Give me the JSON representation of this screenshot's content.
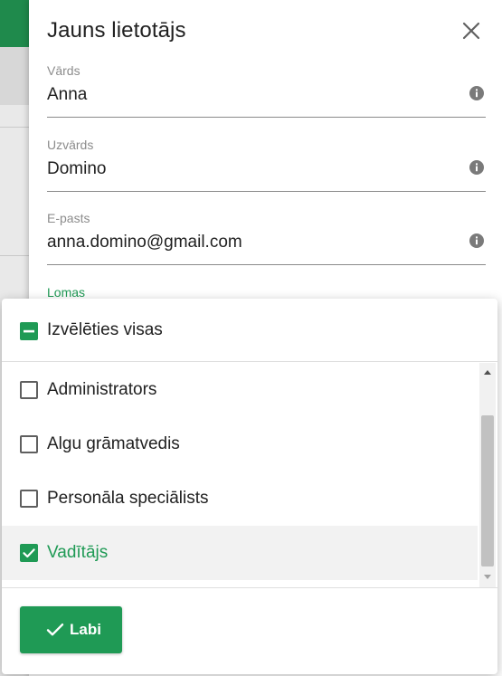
{
  "drawer": {
    "title": "Jauns lietotājs",
    "close_icon": "close-icon"
  },
  "fields": [
    {
      "label": "Vārds",
      "value": "Anna",
      "icon": "info-icon"
    },
    {
      "label": "Uzvārds",
      "value": "Domino",
      "icon": "info-icon"
    },
    {
      "label": "E-pasts",
      "value": "anna.domino@gmail.com",
      "icon": "info-icon"
    }
  ],
  "roles": {
    "label": "Lomas",
    "select_all_label": "Izvēlēties visas",
    "select_all_state": "indeterminate",
    "options": [
      {
        "label": "Administrators",
        "checked": false
      },
      {
        "label": "Algu grāmatvedis",
        "checked": false
      },
      {
        "label": "Personāla speciālists",
        "checked": false
      },
      {
        "label": "Vadītājs",
        "checked": true
      }
    ],
    "ok_label": "Labi"
  },
  "colors": {
    "accent": "#1f9a55",
    "header_green": "#1f8a4c"
  }
}
